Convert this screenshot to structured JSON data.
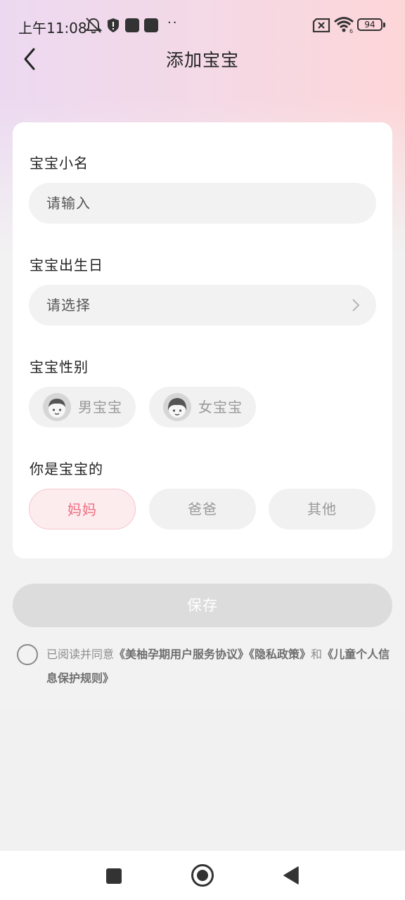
{
  "status_bar": {
    "time": "上午11:08",
    "dots": "··",
    "battery": "94",
    "icons": [
      "bell-off-icon",
      "shield-icon",
      "notification-square-icon",
      "notification-square-icon",
      "sim-error-icon",
      "wifi-icon",
      "battery-icon"
    ]
  },
  "header": {
    "title": "添加宝宝",
    "back_icon": "chevron-left-icon"
  },
  "form": {
    "nickname": {
      "label": "宝宝小名",
      "placeholder": "请输入",
      "value": ""
    },
    "birthday": {
      "label": "宝宝出生日",
      "placeholder": "请选择",
      "icon": "chevron-right-icon"
    },
    "gender": {
      "label": "宝宝性别",
      "options": [
        {
          "label": "男宝宝",
          "icon": "boy-avatar-icon",
          "selected": false
        },
        {
          "label": "女宝宝",
          "icon": "girl-avatar-icon",
          "selected": false
        }
      ]
    },
    "relation": {
      "label": "你是宝宝的",
      "options": [
        {
          "label": "妈妈",
          "selected": true
        },
        {
          "label": "爸爸",
          "selected": false
        },
        {
          "label": "其他",
          "selected": false
        }
      ]
    }
  },
  "save_label": "保存",
  "agreement": {
    "checked": false,
    "prefix": "已阅读并同意",
    "link1": "《美柚孕期用户服务协议》",
    "link2": "《隐私政策》",
    "and": "和",
    "link3": "《儿童个人信息保护规则》"
  },
  "colors": {
    "accent": "#ef6b80",
    "selected_bg": "#fdecee",
    "field_bg": "#f2f2f2",
    "save_disabled": "#dcdcdc"
  },
  "system_nav": {
    "icons": [
      "recent-apps-icon",
      "home-icon",
      "back-triangle-icon"
    ]
  }
}
